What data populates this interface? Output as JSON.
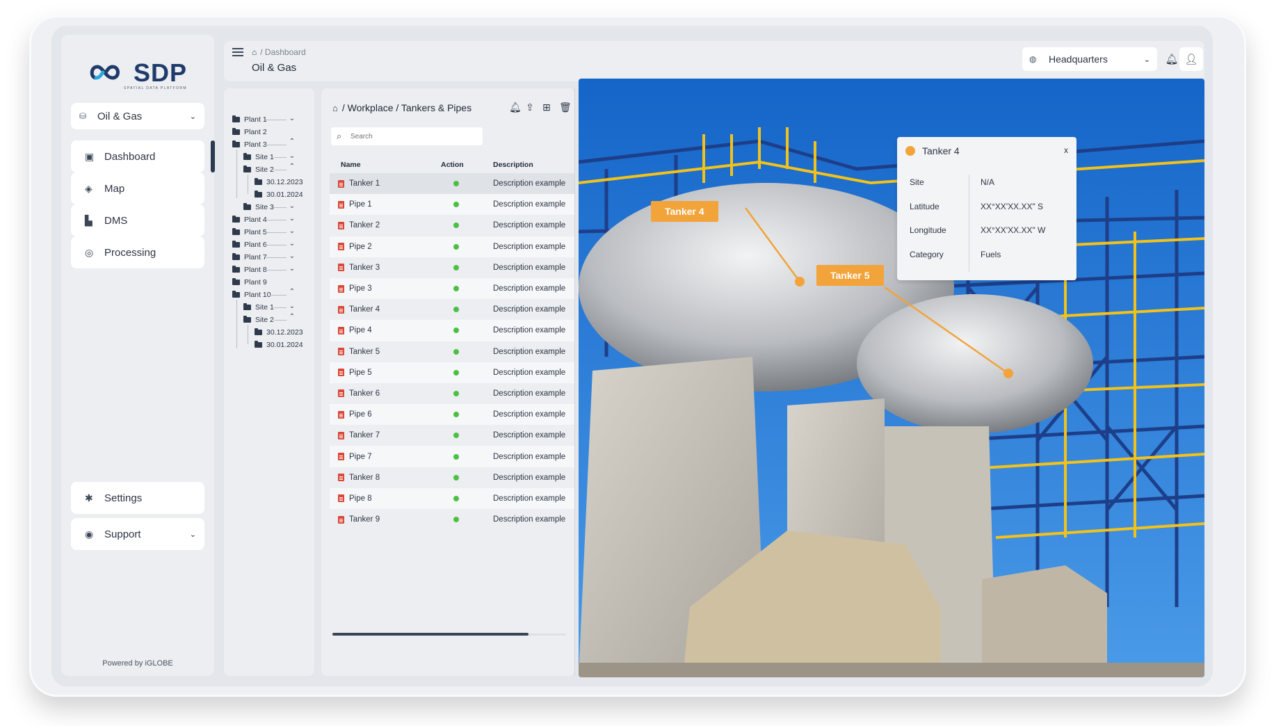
{
  "brand": {
    "name": "SDP",
    "tagline": "SPATIAL DATA PLATFORM",
    "powered_by": "Powered by iGLOBE"
  },
  "sidebar": {
    "project": "Oil & Gas",
    "items": [
      {
        "label": "Dashboard",
        "icon": "dashboard-icon"
      },
      {
        "label": "Map",
        "icon": "map-icon"
      },
      {
        "label": "DMS",
        "icon": "dms-icon"
      },
      {
        "label": "Processing",
        "icon": "processing-icon"
      }
    ],
    "bottom_items": [
      {
        "label": "Settings",
        "icon": "gear-icon"
      },
      {
        "label": "Support",
        "icon": "support-icon"
      }
    ]
  },
  "header": {
    "breadcrumb": "/ Dashboard",
    "title": "Oil & Gas",
    "location": "Headquarters"
  },
  "tree": [
    "Plant 1",
    "Plant 2",
    "Plant 3",
    "Site 1",
    "Site 2",
    "30.12.2023",
    "30.01.2024",
    "Site 3",
    "Plant 4",
    "Plant 5",
    "Plant 6",
    "Plant 7",
    "Plant 8",
    "Plant 9",
    "Plant 10",
    "Site 1",
    "Site 2",
    "30.12.2023",
    "30.01.2024"
  ],
  "list": {
    "breadcrumb": "/ Workplace / Tankers & Pipes",
    "search_placeholder": "Search",
    "columns": {
      "name": "Name",
      "action": "Action",
      "description": "Description"
    },
    "rows": [
      {
        "name": "Tanker 1",
        "description": "Description example"
      },
      {
        "name": "Pipe 1",
        "description": "Description example"
      },
      {
        "name": "Tanker 2",
        "description": "Description example"
      },
      {
        "name": "Pipe 2",
        "description": "Description example"
      },
      {
        "name": "Tanker 3",
        "description": "Description example"
      },
      {
        "name": "Pipe 3",
        "description": "Description example"
      },
      {
        "name": "Tanker 4",
        "description": "Description example"
      },
      {
        "name": "Pipe 4",
        "description": "Description example"
      },
      {
        "name": "Tanker 5",
        "description": "Description example"
      },
      {
        "name": "Pipe 5",
        "description": "Description example"
      },
      {
        "name": "Tanker 6",
        "description": "Description example"
      },
      {
        "name": "Pipe 6",
        "description": "Description example"
      },
      {
        "name": "Tanker 7",
        "description": "Description example"
      },
      {
        "name": "Pipe 7",
        "description": "Description example"
      },
      {
        "name": "Tanker 8",
        "description": "Description example"
      },
      {
        "name": "Pipe 8",
        "description": "Description example"
      },
      {
        "name": "Tanker 9",
        "description": "Description example"
      }
    ],
    "status_color": "#4cc043"
  },
  "photo": {
    "labels": [
      "Tanker 4",
      "Tanker 5"
    ],
    "label_color": "#f2a33a"
  },
  "popup": {
    "title": "Tanker 4",
    "close": "x",
    "fields": [
      {
        "key": "Site",
        "value": "N/A"
      },
      {
        "key": "Latitude",
        "value": "XX°XX'XX.XX\" S"
      },
      {
        "key": "Longitude",
        "value": "XX°XX'XX.XX\" W"
      },
      {
        "key": "Category",
        "value": "Fuels"
      }
    ]
  }
}
